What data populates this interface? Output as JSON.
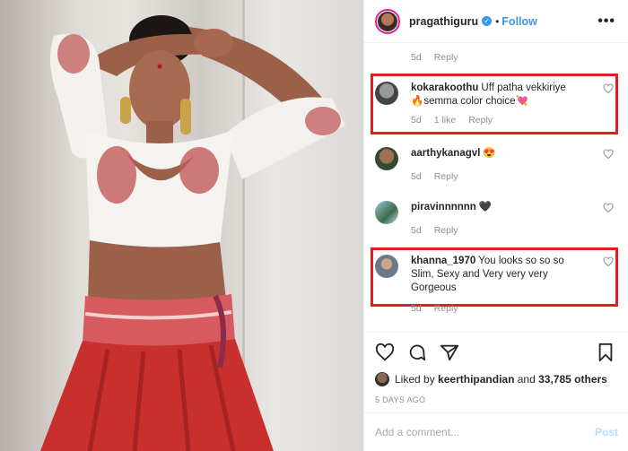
{
  "header": {
    "username": "pragathiguru",
    "follow_label": "Follow",
    "separator": "•",
    "more_icon": "•••"
  },
  "top_meta": {
    "time": "5d",
    "reply": "Reply"
  },
  "comments": [
    {
      "username": "kokarakoothu",
      "text": "Uff patha vekkiriye 🔥semma color choice💘",
      "time": "5d",
      "likes": "1 like",
      "reply": "Reply",
      "highlighted": true
    },
    {
      "username": "aarthykanagvl",
      "text": "😍",
      "time": "5d",
      "reply": "Reply",
      "highlighted": false
    },
    {
      "username": "piravinnnnnn",
      "text": "🖤",
      "time": "5d",
      "reply": "Reply",
      "highlighted": false
    },
    {
      "username": "khanna_1970",
      "text": "You looks so so so Slim, Sexy and Very very very Gorgeous",
      "time": "5d",
      "reply": "Reply",
      "highlighted": true
    }
  ],
  "likes": {
    "prefix": "Liked by",
    "user": "keerthipandian",
    "conj": "and",
    "count": "33,785 others"
  },
  "timestamp": "5 DAYS AGO",
  "add_comment": {
    "placeholder": "Add a comment...",
    "post_label": "Post"
  },
  "colors": {
    "accent": "#3897f0",
    "highlight": "#e02020",
    "skirt": "#c8302e"
  },
  "icons": [
    "verified-badge-icon",
    "more-options-icon",
    "heart-icon",
    "comment-icon",
    "share-icon",
    "bookmark-icon"
  ]
}
